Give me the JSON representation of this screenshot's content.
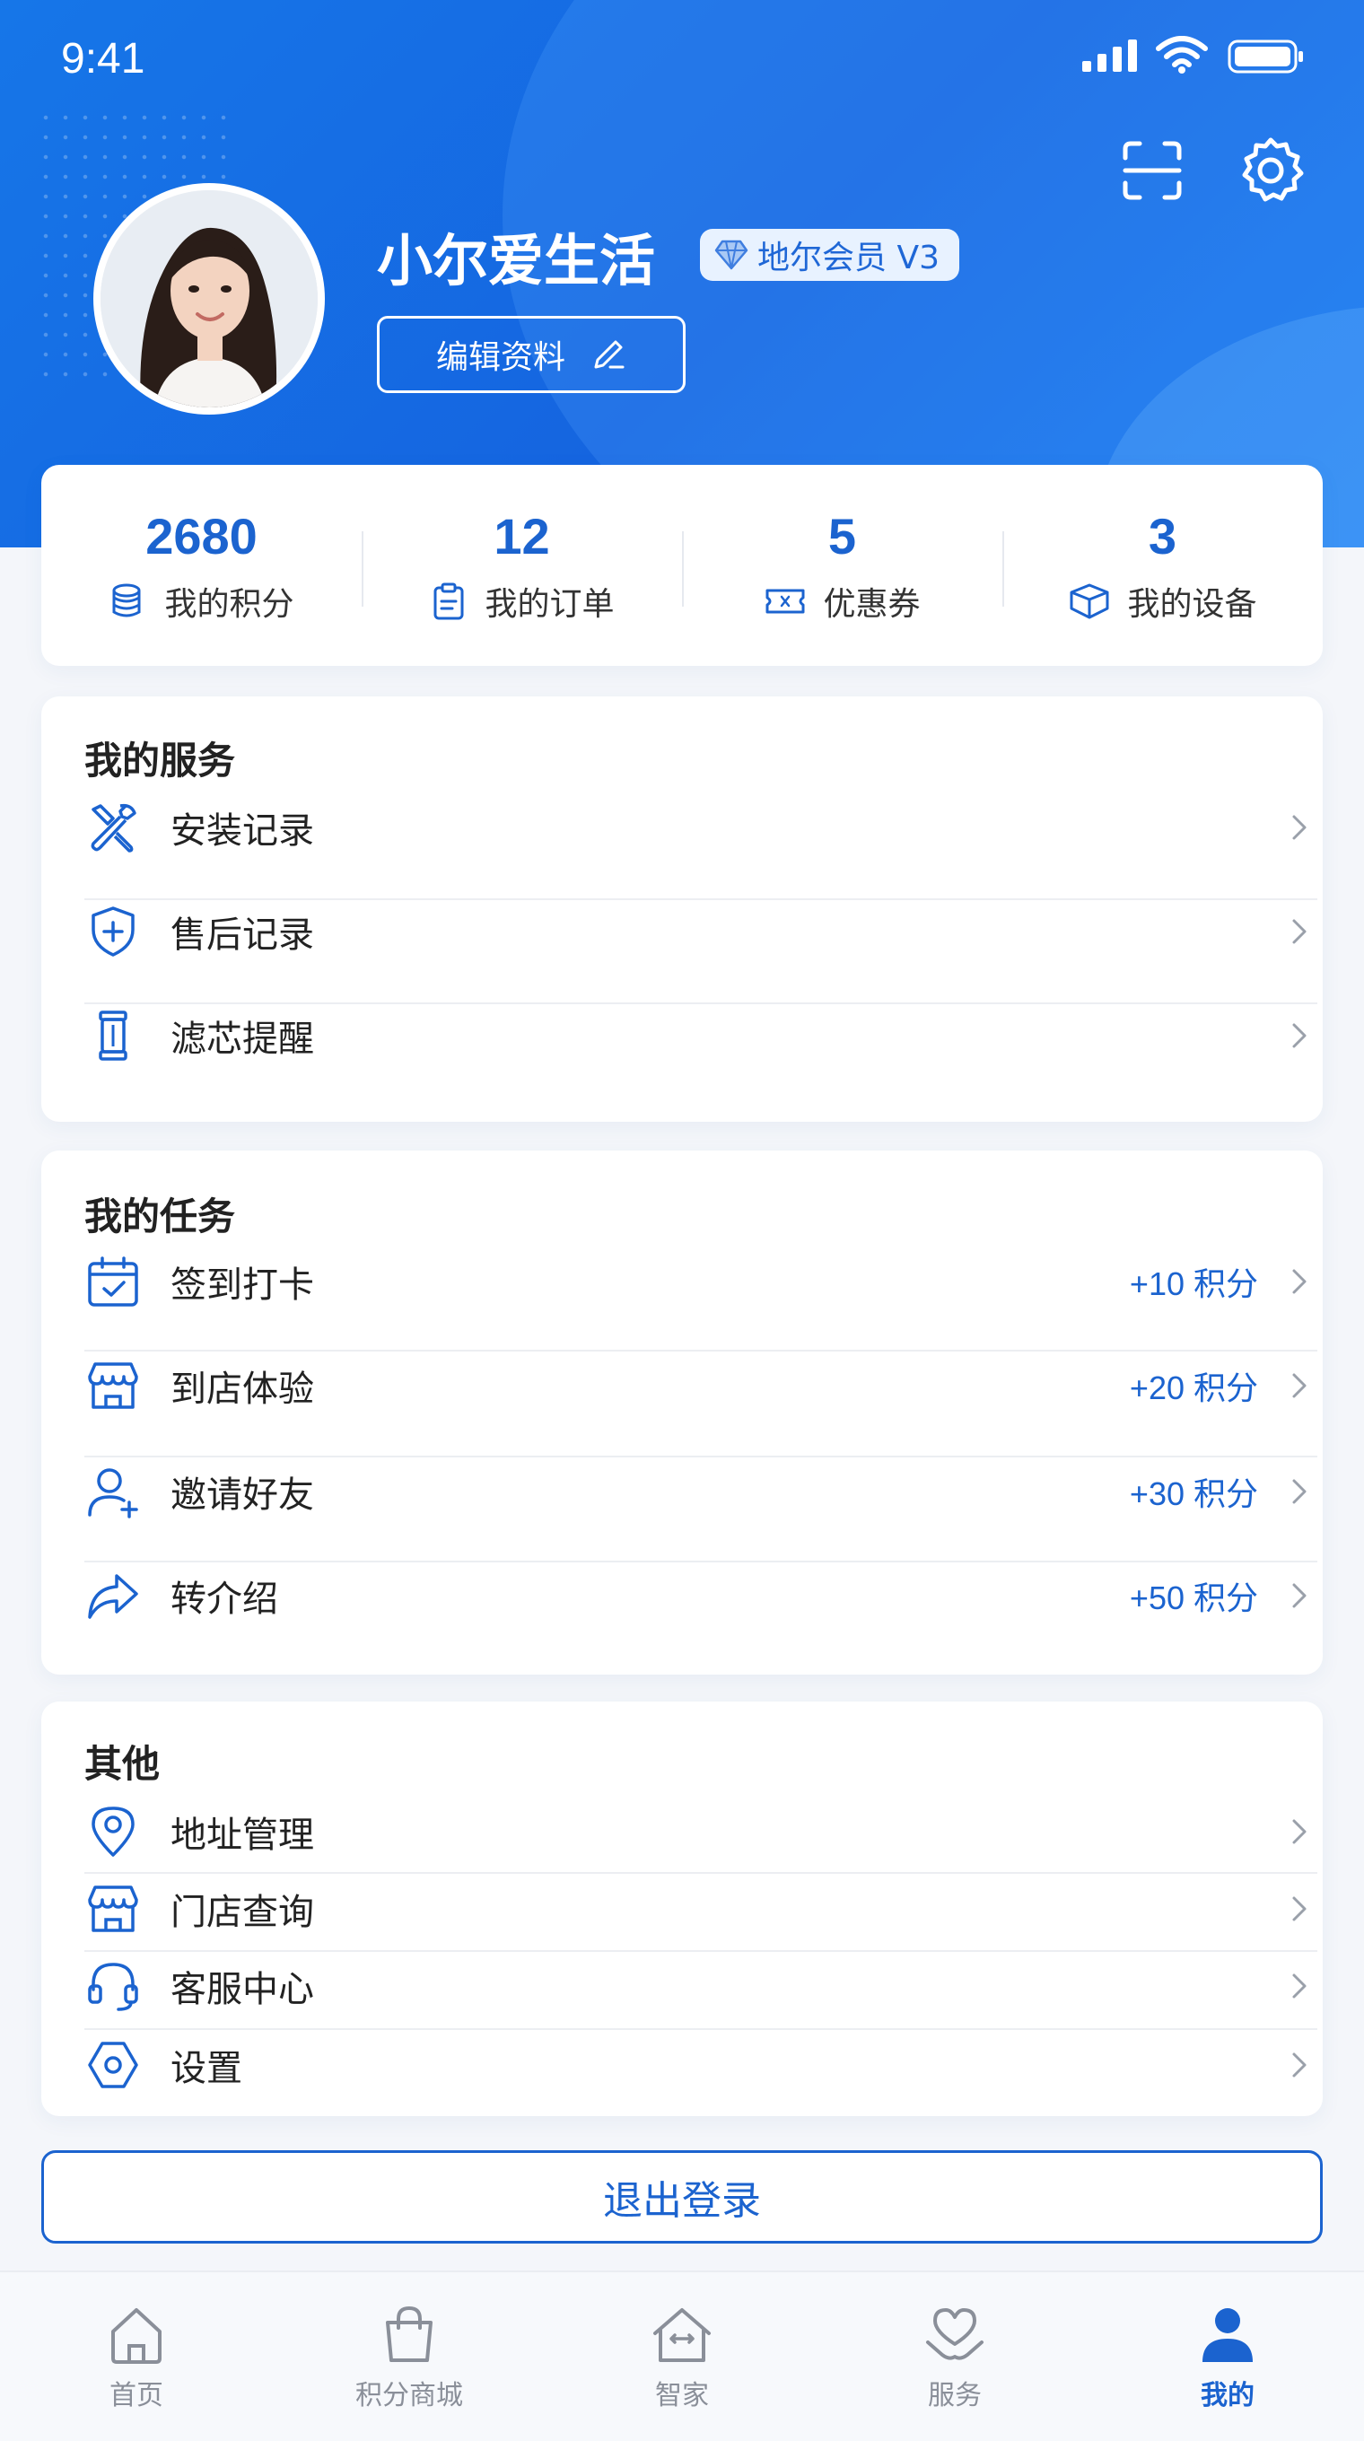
{
  "status_bar": {
    "time": "9:41"
  },
  "profile": {
    "username": "小尔爱生活",
    "member_badge": "地尔会员 V3",
    "edit_label": "编辑资料"
  },
  "stats": [
    {
      "value": "2680",
      "label": "我的积分",
      "icon": "coins-icon"
    },
    {
      "value": "12",
      "label": "我的订单",
      "icon": "clipboard-icon"
    },
    {
      "value": "5",
      "label": "优惠券",
      "icon": "ticket-icon"
    },
    {
      "value": "3",
      "label": "我的设备",
      "icon": "device-box-icon"
    }
  ],
  "services": {
    "title": "我的服务",
    "items": [
      {
        "label": "安装记录",
        "icon": "tools-icon"
      },
      {
        "label": "售后记录",
        "icon": "shield-plus-icon"
      },
      {
        "label": "滤芯提醒",
        "icon": "filter-cartridge-icon"
      }
    ]
  },
  "tasks": {
    "title": "我的任务",
    "items": [
      {
        "label": "签到打卡",
        "reward": "+10 积分",
        "icon": "calendar-check-icon"
      },
      {
        "label": "到店体验",
        "reward": "+20 积分",
        "icon": "store-icon"
      },
      {
        "label": "邀请好友",
        "reward": "+30 积分",
        "icon": "user-add-icon"
      },
      {
        "label": "转介绍",
        "reward": "+50 积分",
        "icon": "share-arrow-icon"
      }
    ]
  },
  "other": {
    "title": "其他",
    "items": [
      {
        "label": "地址管理",
        "icon": "location-pin-icon"
      },
      {
        "label": "门店查询",
        "icon": "store-icon"
      },
      {
        "label": "客服中心",
        "icon": "headset-icon"
      },
      {
        "label": "设置",
        "icon": "hexagon-settings-icon"
      }
    ]
  },
  "logout_label": "退出登录",
  "tab_bar": [
    {
      "label": "首页",
      "icon": "home-icon",
      "active": false
    },
    {
      "label": "积分商城",
      "icon": "shopping-bag-icon",
      "active": false
    },
    {
      "label": "智家",
      "icon": "smart-home-icon",
      "active": false
    },
    {
      "label": "服务",
      "icon": "heart-hand-icon",
      "active": false
    },
    {
      "label": "我的",
      "icon": "user-icon",
      "active": true
    }
  ],
  "colors": {
    "primary": "#1b63cf",
    "header_blue": "#1676e8",
    "page_bg": "#f4f6fa"
  }
}
